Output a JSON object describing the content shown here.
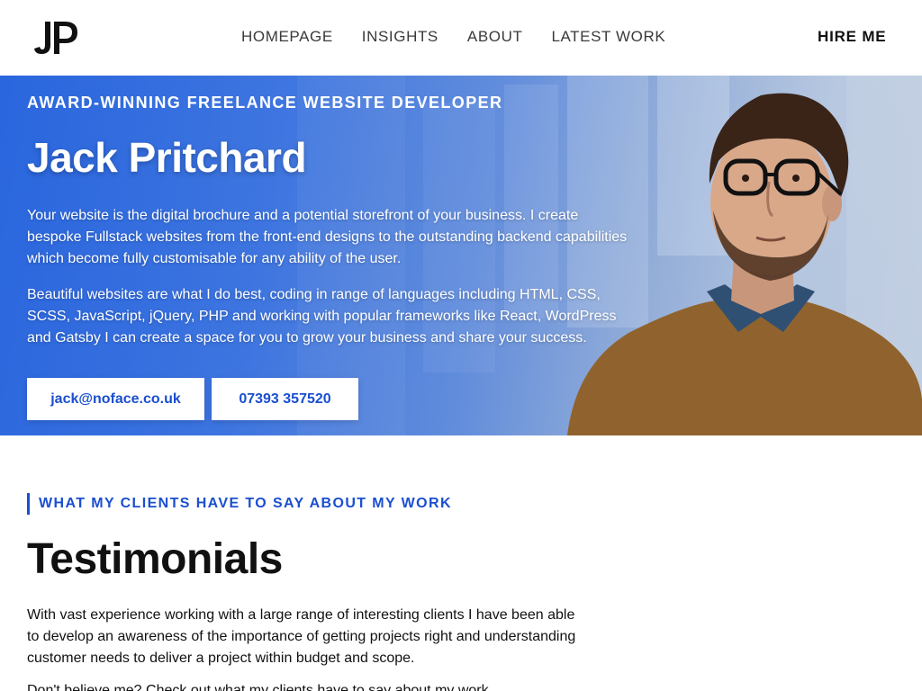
{
  "brand": {
    "logo_alt": "JP",
    "colors": {
      "accent": "#1a4fd0",
      "hero_blue": "#2a66de"
    }
  },
  "nav": {
    "items": [
      {
        "label": "HOMEPAGE"
      },
      {
        "label": "INSIGHTS"
      },
      {
        "label": "ABOUT"
      },
      {
        "label": "LATEST WORK"
      }
    ],
    "cta": "HIRE ME"
  },
  "hero": {
    "kicker": "AWARD-WINNING FREELANCE WEBSITE DEVELOPER",
    "name": "Jack Pritchard",
    "paragraph1": "Your website is the digital brochure and a potential storefront of your business. I create bespoke Fullstack websites from the front-end designs to the outstanding backend capabilities which become fully customisable for any ability of the user.",
    "paragraph2": "Beautiful websites are what I do best, coding in range of languages including HTML, CSS, SCSS, JavaScript, jQuery, PHP and working with popular frameworks like React, WordPress and Gatsby I can create a space for you to grow your business and share your success.",
    "email": "jack@noface.co.uk",
    "phone": "07393 357520"
  },
  "testimonials": {
    "kicker": "WHAT MY CLIENTS HAVE TO SAY ABOUT MY WORK",
    "title": "Testimonials",
    "paragraph1": "With vast experience working with a large range of interesting clients I have been able to develop an awareness of the importance of getting projects right and understanding customer needs to deliver a project within budget and scope.",
    "paragraph2": "Don't believe me? Check out what my clients have to say about my work."
  }
}
